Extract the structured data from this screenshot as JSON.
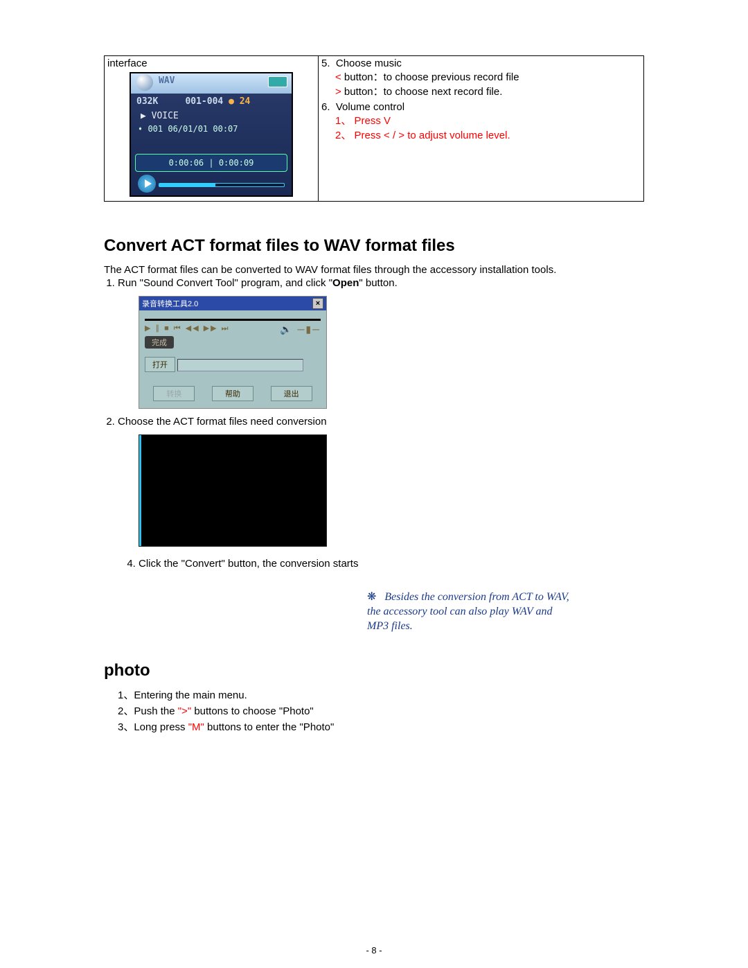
{
  "topTable": {
    "leftLabel": "interface",
    "device": {
      "topLabel": "WAV",
      "line1_left": "032K",
      "line1_mid": "001-004",
      "line1_right": "24",
      "voice": "VOICE",
      "info": "001 06/01/01 00:07",
      "time": "0:00:06  |  0:00:09"
    },
    "right": {
      "item5num": "5.",
      "item5title": "Choose music",
      "item5a_sym": "<",
      "item5a_txt": " button：to choose previous record file",
      "item5b_sym": ">",
      "item5b_txt": " button：to choose next record file.",
      "item6num": "6.",
      "item6title": "Volume control",
      "item6a": "1、 Press V",
      "item6b": "2、 Press < / > to adjust volume level."
    }
  },
  "sectionTitle": "Convert ACT format files to WAV format files",
  "intro": "The ACT format files can be converted to WAV format files through the accessory installation tools.",
  "step1_pre": "Run \"Sound Convert Tool\" program, and click \"",
  "step1_bold": "Open",
  "step1_post": "\" button.",
  "soundTool": {
    "title": "录音转换工具2.0",
    "done": "完成",
    "open": "打开",
    "btnConvert": "转换",
    "btnHelp": "帮助",
    "btnExit": "退出"
  },
  "step2": "Choose the ACT format files need conversion",
  "step4": "Click the \"Convert\" button, the conversion starts",
  "aside": {
    "burst": "❋",
    "text": "Besides the conversion from ACT to WAV, the accessory tool can also play WAV and MP3 files."
  },
  "photoTitle": "photo",
  "photo": {
    "l1": "1、Entering the main menu.",
    "l2a": "2、Push the ",
    "l2b": "\">\"",
    "l2c": " buttons to choose \"Photo\"",
    "l3a": "3、Long press ",
    "l3b": "\"M\"",
    "l3c": " buttons to enter the \"Photo\""
  },
  "pageNum": "- 8 -"
}
